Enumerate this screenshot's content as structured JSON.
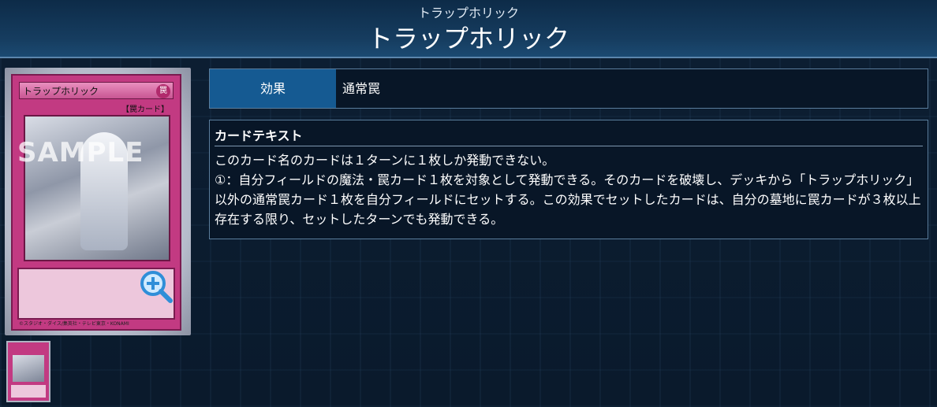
{
  "header": {
    "ruby": "トラップホリック",
    "title": "トラップホリック"
  },
  "card": {
    "name": "トラップホリック",
    "attribute": "罠",
    "type_line": "【罠カード】",
    "watermark": "SAMPLE",
    "credit": "©スタジオ・ダイス/集英社・テレビ東京・KONAMI"
  },
  "effect": {
    "label": "効果",
    "value": "通常罠"
  },
  "card_text": {
    "heading": "カードテキスト",
    "body": "このカード名のカードは１ターンに１枚しか発動できない。\n①：自分フィールドの魔法・罠カード１枚を対象として発動できる。そのカードを破壊し、デッキから「トラップホリック」以外の通常罠カード１枚を自分フィールドにセットする。この効果でセットしたカードは、自分の墓地に罠カードが３枚以上存在する限り、セットしたターンでも発動できる。"
  },
  "icons": {
    "zoom": "zoom-in-icon"
  },
  "colors": {
    "accent": "#155a92",
    "card_trap": "#c23a82",
    "background": "#0a1a2c"
  }
}
